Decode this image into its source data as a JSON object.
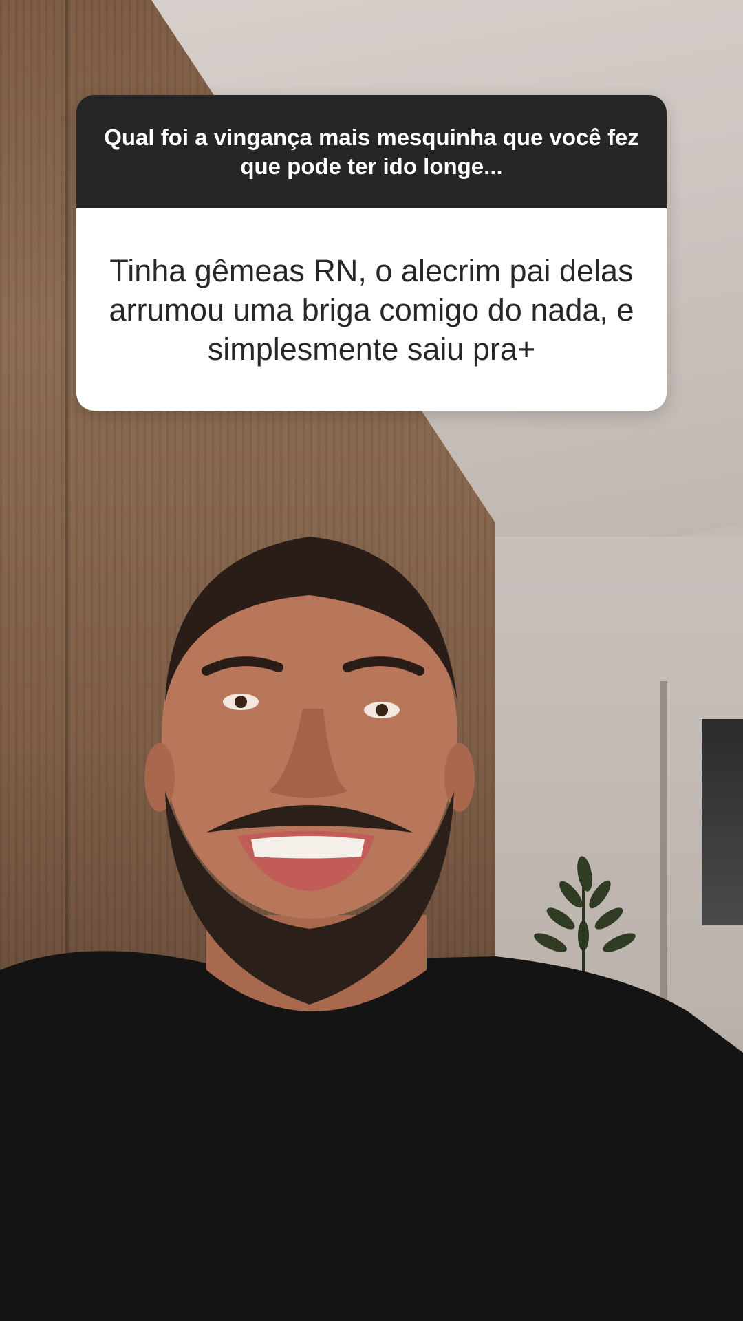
{
  "story": {
    "question_sticker": {
      "question": "Qual foi a vingança mais mesquinha que você fez que pode ter ido longe...",
      "answer": "Tinha gêmeas RN, o alecrim pai delas arrumou uma briga comigo do nada, e simplesmente saiu pra+",
      "colors": {
        "header_background": "#262626",
        "header_text": "#ffffff",
        "body_background": "#ffffff",
        "body_text": "#262626"
      }
    },
    "background": {
      "description_icon": "video-frame"
    }
  }
}
